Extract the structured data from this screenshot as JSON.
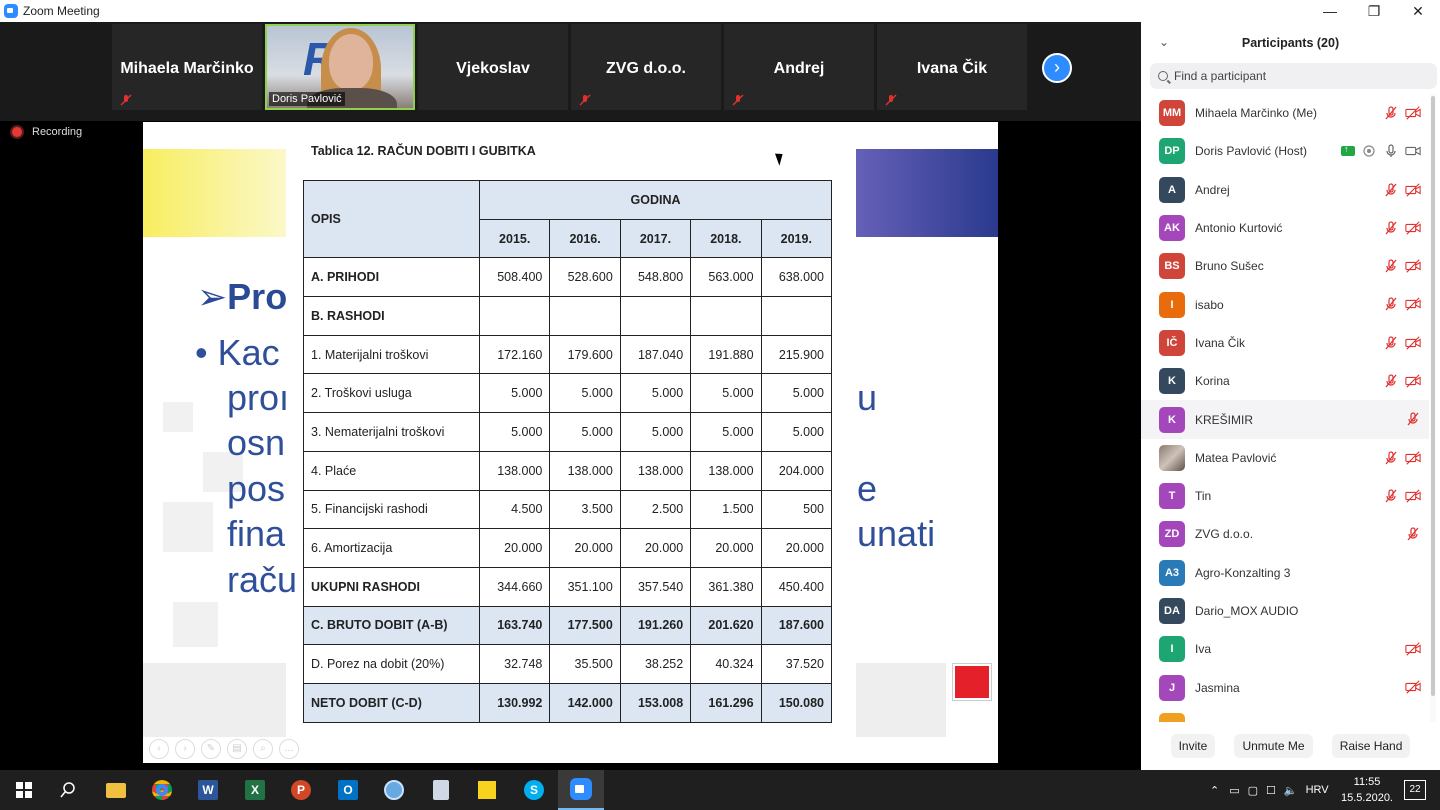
{
  "window": {
    "title": "Zoom Meeting",
    "minimize": "—",
    "restore": "❐",
    "close": "✕"
  },
  "gallery": {
    "tiles": [
      {
        "name": "Mihaela Marčinko",
        "muted": true
      },
      {
        "name": "Doris Pavlović",
        "video": true
      },
      {
        "name": "Vjekoslav",
        "muted": false
      },
      {
        "name": "ZVG d.o.o.",
        "muted": true
      },
      {
        "name": "Andrej",
        "muted": true
      },
      {
        "name": "Ivana Čik",
        "muted": true
      }
    ],
    "next_label": "›"
  },
  "recording": {
    "label": "Recording"
  },
  "slide": {
    "background_text": {
      "heading": "Pro",
      "bullet": "Kac",
      "lines": [
        "proı",
        "osn",
        "pos",
        "fina",
        "raču"
      ],
      "right_fragments": [
        "u",
        "e",
        "unati"
      ]
    },
    "table_title": "Tablica 12. RAČUN DOBITI I GUBITKA",
    "col_opis": "OPIS",
    "col_godina": "GODINA",
    "years": [
      "2015.",
      "2016.",
      "2017.",
      "2018.",
      "2019."
    ],
    "rows": [
      {
        "label": "A. PRIHODI",
        "values": [
          "508.400",
          "528.600",
          "548.800",
          "563.000",
          "638.000"
        ],
        "style": "bold-label"
      },
      {
        "label": "B. RASHODI",
        "values": [
          "",
          "",
          "",
          "",
          ""
        ],
        "style": "bold-label"
      },
      {
        "label": "1. Materijalni troškovi",
        "values": [
          "172.160",
          "179.600",
          "187.040",
          "191.880",
          "215.900"
        ],
        "style": ""
      },
      {
        "label": "2. Troškovi usluga",
        "values": [
          "5.000",
          "5.000",
          "5.000",
          "5.000",
          "5.000"
        ],
        "style": ""
      },
      {
        "label": "3. Nematerijalni troškovi",
        "values": [
          "5.000",
          "5.000",
          "5.000",
          "5.000",
          "5.000"
        ],
        "style": ""
      },
      {
        "label": "4. Plaće",
        "values": [
          "138.000",
          "138.000",
          "138.000",
          "138.000",
          "204.000"
        ],
        "style": ""
      },
      {
        "label": "5. Financijski rashodi",
        "values": [
          "4.500",
          "3.500",
          "2.500",
          "1.500",
          "500"
        ],
        "style": ""
      },
      {
        "label": "6. Amortizacija",
        "values": [
          "20.000",
          "20.000",
          "20.000",
          "20.000",
          "20.000"
        ],
        "style": ""
      },
      {
        "label": "UKUPNI RASHODI",
        "values": [
          "344.660",
          "351.100",
          "357.540",
          "361.380",
          "450.400"
        ],
        "style": "bold-label"
      },
      {
        "label": "C. BRUTO DOBIT (A-B)",
        "values": [
          "163.740",
          "177.500",
          "191.260",
          "201.620",
          "187.600"
        ],
        "style": "highlight"
      },
      {
        "label": "D. Porez na dobit (20%)",
        "values": [
          "32.748",
          "35.500",
          "38.252",
          "40.324",
          "37.520"
        ],
        "style": ""
      },
      {
        "label": "NETO DOBIT (C-D)",
        "values": [
          "130.992",
          "142.000",
          "153.008",
          "161.296",
          "150.080"
        ],
        "style": "highlight"
      }
    ]
  },
  "participants": {
    "title": "Participants (20)",
    "search_placeholder": "Find a participant",
    "list": [
      {
        "initials": "MM",
        "name": "Mihaela Marčinko (Me)",
        "color": "#d0453a",
        "mic": "muted",
        "video": "off"
      },
      {
        "initials": "DP",
        "name": "Doris Pavlović (Host)",
        "color": "#1ea672",
        "mic": "on",
        "video": "on",
        "sharing": true
      },
      {
        "initials": "A",
        "name": "Andrej",
        "color": "#34495e",
        "mic": "muted",
        "video": "off"
      },
      {
        "initials": "AK",
        "name": "Antonio Kurtović",
        "color": "#a347ba",
        "mic": "muted",
        "video": "off"
      },
      {
        "initials": "BS",
        "name": "Bruno Sušec",
        "color": "#d0453a",
        "mic": "muted",
        "video": "off"
      },
      {
        "initials": "I",
        "name": "isabo",
        "color": "#e86c0c",
        "mic": "muted",
        "video": "off"
      },
      {
        "initials": "IČ",
        "name": "Ivana Čik",
        "color": "#d0453a",
        "mic": "muted",
        "video": "off"
      },
      {
        "initials": "K",
        "name": "Korina",
        "color": "#34495e",
        "mic": "muted",
        "video": "off"
      },
      {
        "initials": "K",
        "name": "KREŠIMIR",
        "color": "#a347ba",
        "mic": "muted",
        "video": "",
        "hover": true
      },
      {
        "initials": "",
        "name": "Matea Pavlović",
        "color": "",
        "photo": true,
        "mic": "muted",
        "video": "off"
      },
      {
        "initials": "T",
        "name": "Tin",
        "color": "#a347ba",
        "mic": "muted",
        "video": "off"
      },
      {
        "initials": "ZD",
        "name": "ZVG d.o.o.",
        "color": "#a347ba",
        "mic": "muted",
        "video": ""
      },
      {
        "initials": "A3",
        "name": "Agro-Konzalting 3",
        "color": "#2a7ab8",
        "mic": "",
        "video": ""
      },
      {
        "initials": "DA",
        "name": "Dario_MOX AUDIO",
        "color": "#34495e",
        "mic": "",
        "video": ""
      },
      {
        "initials": "I",
        "name": "Iva",
        "color": "#1ea672",
        "mic": "",
        "video": "off"
      },
      {
        "initials": "J",
        "name": "Jasmina",
        "color": "#a347ba",
        "mic": "",
        "video": "off"
      },
      {
        "initials": "",
        "name": "",
        "color": "#f0a020",
        "mic": "",
        "video": ""
      }
    ],
    "buttons": {
      "invite": "Invite",
      "unmute": "Unmute Me",
      "raise_hand": "Raise Hand"
    }
  },
  "taskbar": {
    "language": "HRV",
    "time": "11:55",
    "date": "15.5.2020.",
    "notifications": "22"
  }
}
